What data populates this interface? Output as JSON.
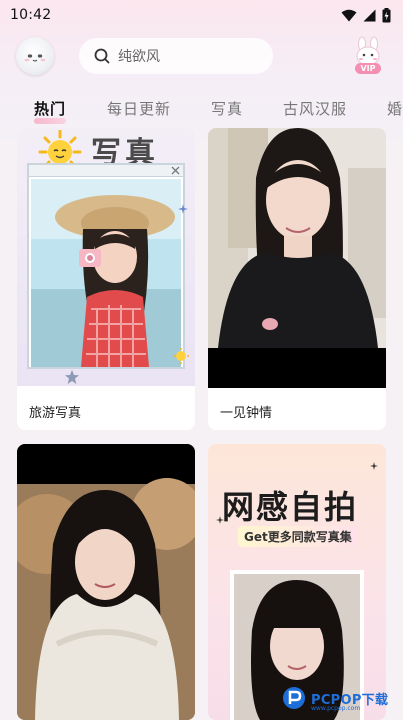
{
  "status_bar": {
    "time": "10:42"
  },
  "header": {
    "search_placeholder": "纯欲风",
    "vip_label": "VIP"
  },
  "tabs": [
    {
      "label": "热门",
      "active": true
    },
    {
      "label": "每日更新",
      "active": false
    },
    {
      "label": "写真",
      "active": false
    },
    {
      "label": "古风汉服",
      "active": false
    },
    {
      "label": "婚",
      "active": false
    }
  ],
  "cards": [
    {
      "caption": "旅游写真",
      "banner_text": "写真"
    },
    {
      "caption": "一见钟情"
    },
    {
      "caption": ""
    },
    {
      "banner_title": "网感自拍",
      "banner_subtitle": "Get更多同款写真集"
    }
  ],
  "watermark": {
    "brand": "PCPOP下载",
    "sub": "www.pcpop.com"
  },
  "colors": {
    "accent_pink": "#f8b6cc",
    "watermark_blue": "#1d6ed8"
  }
}
